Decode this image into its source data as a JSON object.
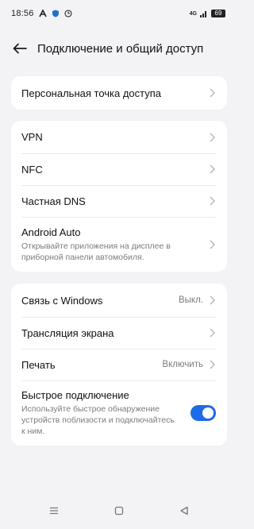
{
  "status": {
    "time": "18:56",
    "network": "4G",
    "battery": "69",
    "notification_icons": [
      "app-a-icon",
      "shield-icon",
      "clock-icon"
    ]
  },
  "header": {
    "title": "Подключение и общий доступ",
    "back_icon": "back-arrow-icon"
  },
  "section1": {
    "items": [
      {
        "label": "Персональная точка доступа"
      }
    ]
  },
  "section2": {
    "items": [
      {
        "label": "VPN"
      },
      {
        "label": "NFC"
      },
      {
        "label": "Частная DNS"
      },
      {
        "label": "Android Auto",
        "subtitle": "Открывайте приложения на дисплее в приборной панели автомобиля."
      }
    ]
  },
  "section3": {
    "items": [
      {
        "label": "Связь с Windows",
        "value": "Выкл."
      },
      {
        "label": "Трансляция экрана"
      },
      {
        "label": "Печать",
        "value": "Включить"
      },
      {
        "label": "Быстрое подключение",
        "subtitle": "Используйте быстрое обнаружение устройств поблизости и подключайтесь к ним.",
        "toggle_on": true
      }
    ]
  },
  "navbar": {
    "icons": [
      "menu-icon",
      "home-icon",
      "back-icon"
    ]
  },
  "colors": {
    "background": "#f3f3f6",
    "card": "#ffffff",
    "accent": "#1e6be6"
  }
}
